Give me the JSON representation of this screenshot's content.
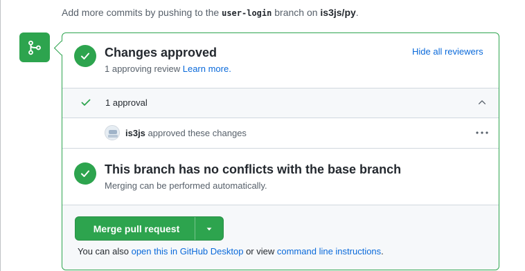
{
  "top_note": {
    "prefix": "Add more commits by pushing to the ",
    "branch": "user-login",
    "middle": " branch on ",
    "repo": "is3js/py",
    "suffix": "."
  },
  "approved": {
    "title": "Changes approved",
    "subtitle_prefix": "1 approving review ",
    "learn_more": "Learn more.",
    "hide_reviewers": "Hide all reviewers"
  },
  "approval_row": {
    "label": "1 approval"
  },
  "reviewer": {
    "name": "is3js",
    "action": " approved these changes"
  },
  "conflicts": {
    "title": "This branch has no conflicts with the base branch",
    "subtitle": "Merging can be performed automatically."
  },
  "merge": {
    "button_label": "Merge pull request",
    "footer_prefix": "You can also ",
    "desktop_link": "open this in GitHub Desktop",
    "footer_middle": " or view ",
    "cli_link": "command line instructions",
    "footer_suffix": "."
  },
  "colors": {
    "success": "#2da44e",
    "link": "#0969da",
    "muted": "#57606a",
    "border": "#d0d7de"
  }
}
